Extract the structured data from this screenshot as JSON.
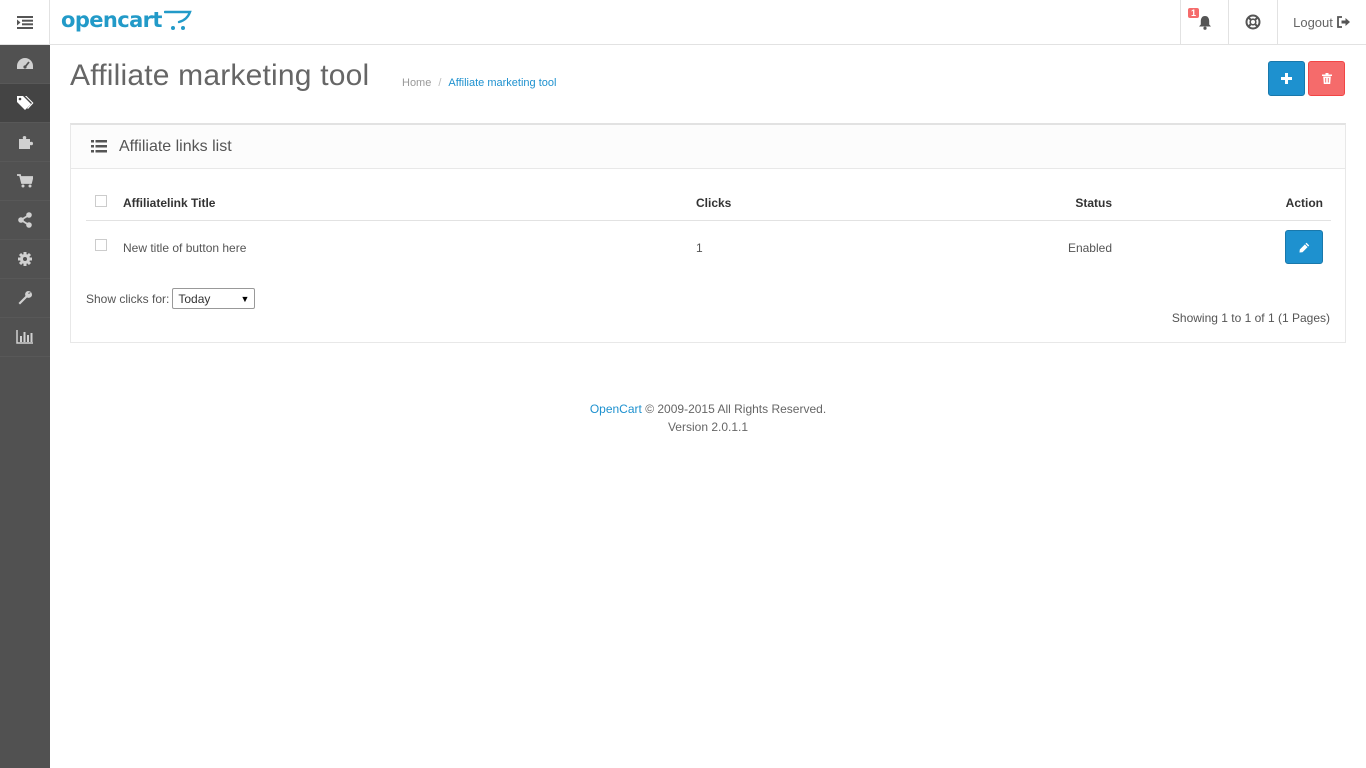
{
  "header": {
    "logo_text": "opencart",
    "notification_count": "1",
    "logout_label": "Logout"
  },
  "sidebar": {
    "items": [
      {
        "icon": "dashboard-icon",
        "active": false
      },
      {
        "icon": "tags-icon",
        "active": true
      },
      {
        "icon": "puzzle-icon",
        "active": false
      },
      {
        "icon": "cart-icon",
        "active": false
      },
      {
        "icon": "share-icon",
        "active": false
      },
      {
        "icon": "gear-icon",
        "active": false
      },
      {
        "icon": "wrench-icon",
        "active": false
      },
      {
        "icon": "bar-chart-icon",
        "active": false
      }
    ]
  },
  "page": {
    "title": "Affiliate marketing tool",
    "breadcrumb": [
      "Home",
      "Affiliate marketing tool"
    ]
  },
  "panel": {
    "title": "Affiliate links list",
    "columns": {
      "title": "Affiliatelink Title",
      "clicks": "Clicks",
      "status": "Status",
      "action": "Action"
    },
    "rows": [
      {
        "title": "New title of button here",
        "clicks": "1",
        "status": "Enabled"
      }
    ],
    "filter_label": "Show clicks for:",
    "filter_value": "Today",
    "pagination_text": "Showing 1 to 1 of 1 (1 Pages)"
  },
  "footer": {
    "brand_link": "OpenCart",
    "copyright": "© 2009-2015 All Rights Reserved.",
    "version": "Version 2.0.1.1"
  },
  "colors": {
    "primary": "#1e91cf",
    "danger": "#f56b6b",
    "sidebar": "#515151",
    "logo": "#229ac8"
  }
}
